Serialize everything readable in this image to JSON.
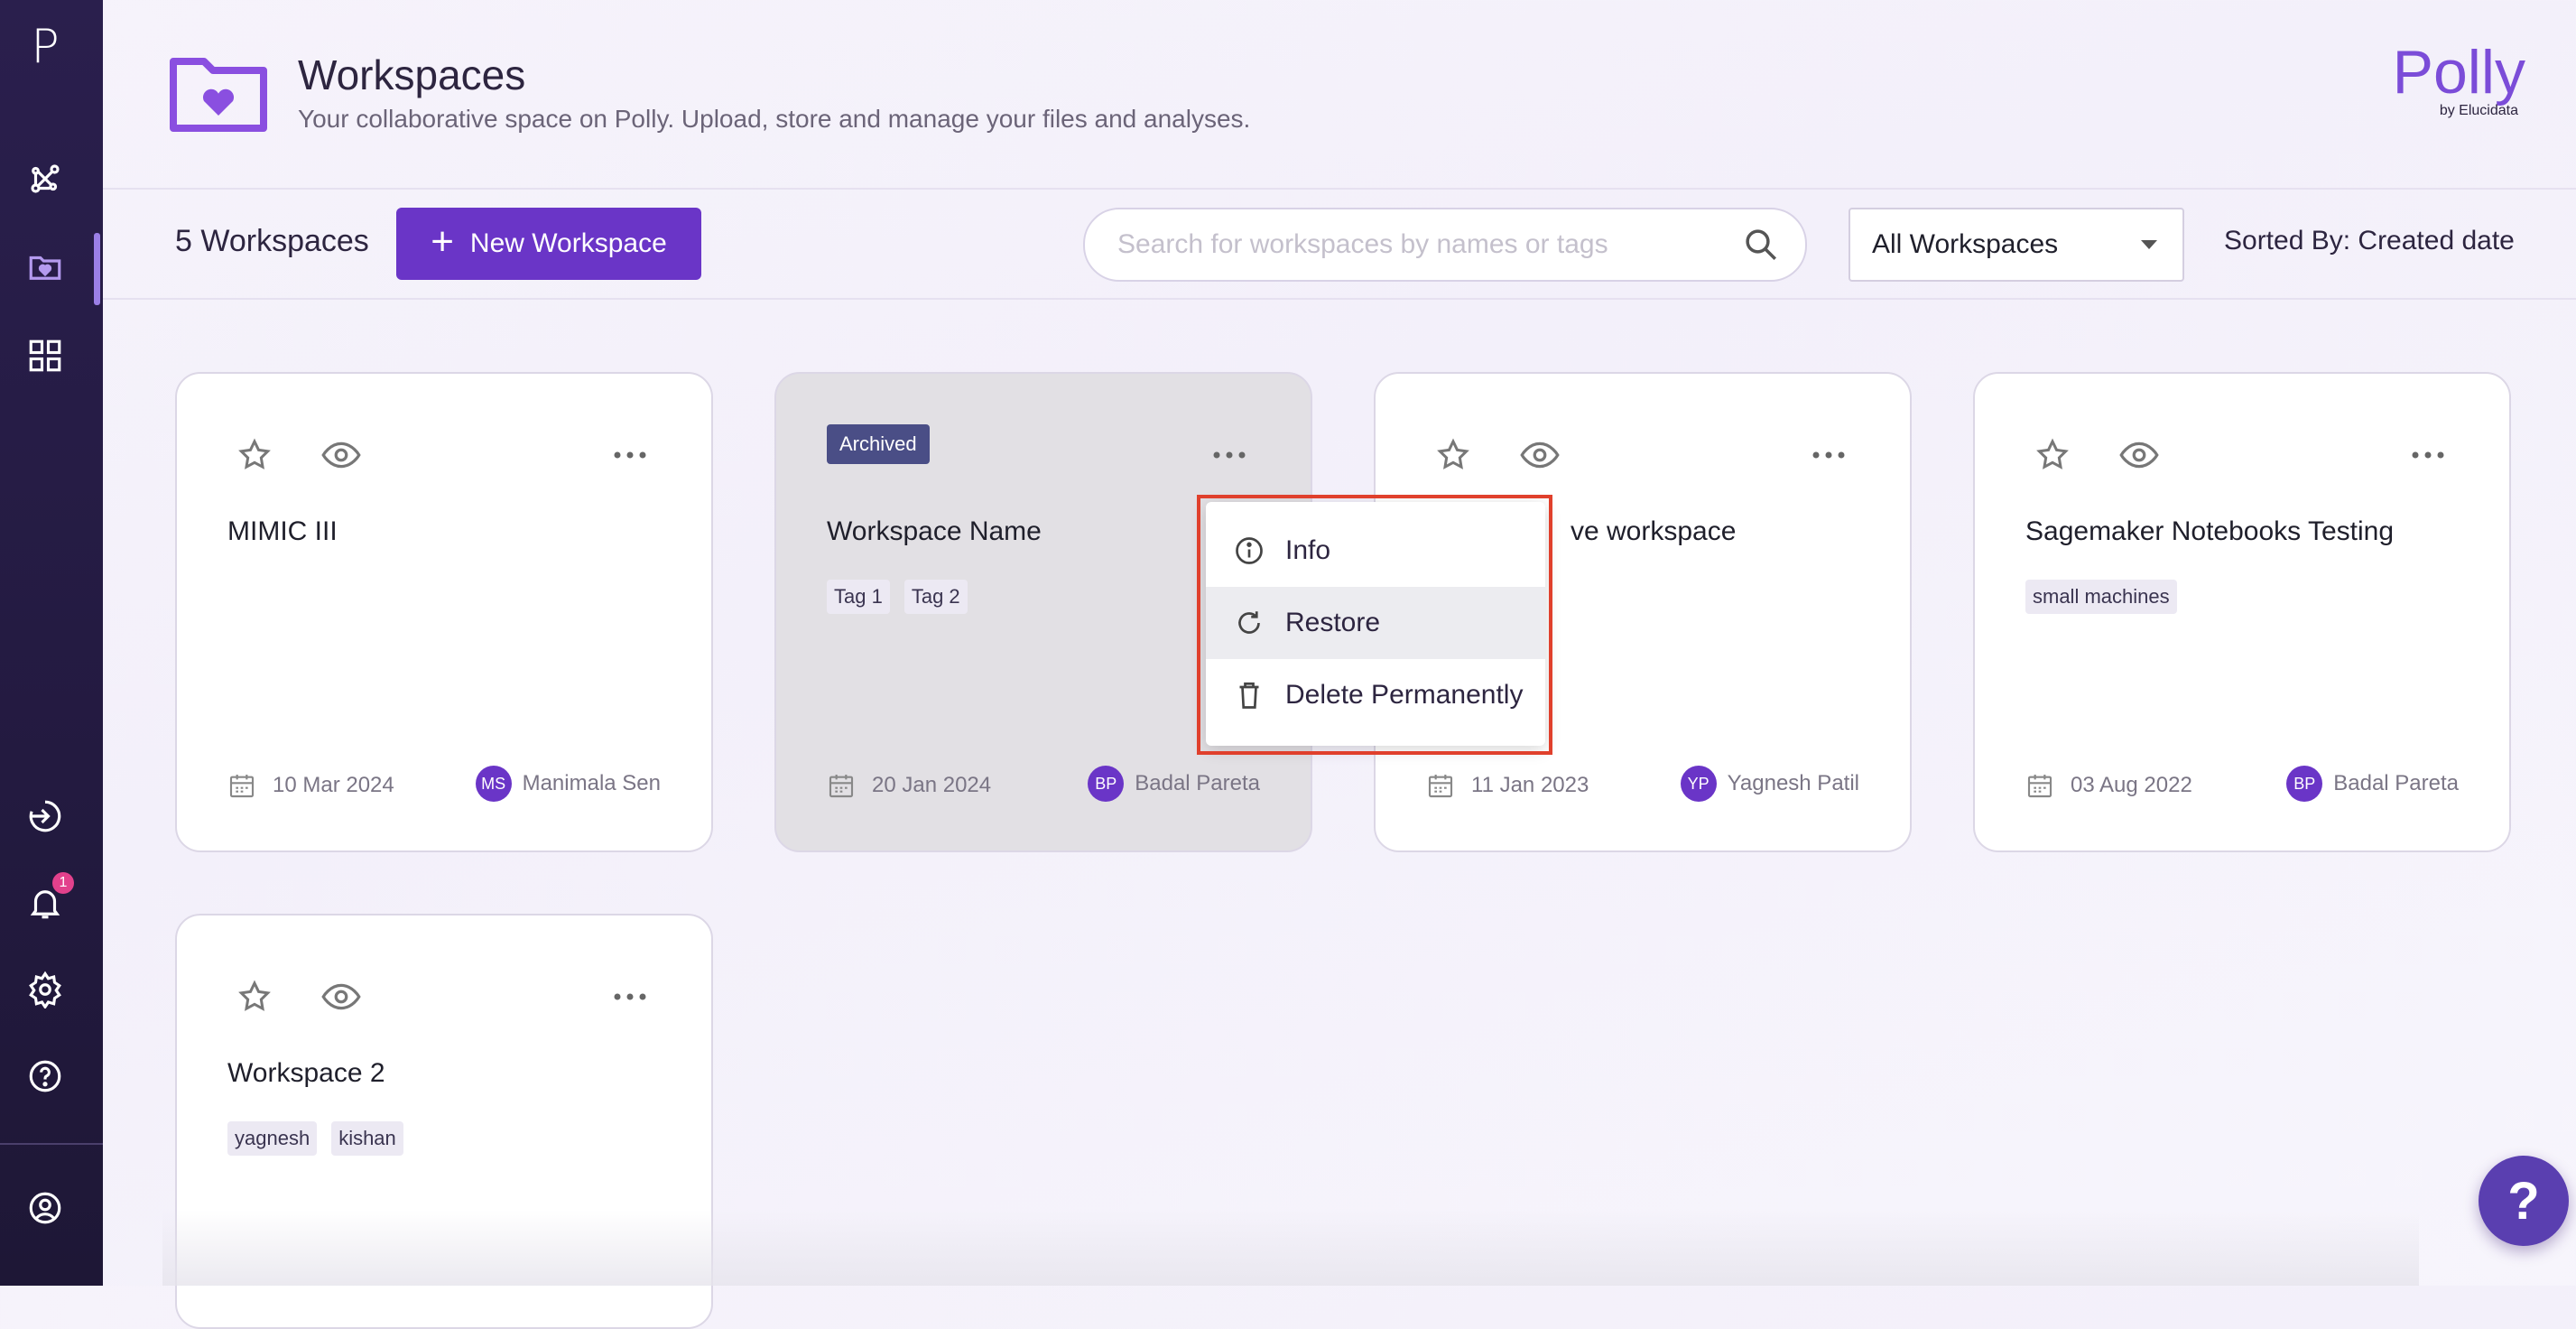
{
  "sidebar": {
    "logo": "P",
    "notification_count": "1",
    "items": [
      {
        "icon": "analysis-icon"
      },
      {
        "icon": "workspaces-icon",
        "active": true
      },
      {
        "icon": "apps-grid-icon"
      },
      {
        "icon": "logout-arrow-icon"
      },
      {
        "icon": "bell-icon"
      },
      {
        "icon": "settings-gear-icon"
      },
      {
        "icon": "help-circle-icon"
      },
      {
        "icon": "account-icon"
      }
    ]
  },
  "header": {
    "title": "Workspaces",
    "subtitle": "Your collaborative space on Polly. Upload, store and manage your files and analyses.",
    "brand": "Polly",
    "brand_sub": "by Elucidata"
  },
  "toolbar": {
    "count_label": "5 Workspaces",
    "new_button_label": "New Workspace",
    "search_placeholder": "Search for workspaces by names or tags",
    "filter_value": "All Workspaces",
    "sort_label": "Sorted By: Created date"
  },
  "cards": [
    {
      "title": "MIMIC III",
      "tags": [],
      "date": "10 Mar 2024",
      "owner_initials": "MS",
      "owner": "Manimala Sen"
    },
    {
      "title": "Workspace Name",
      "archived_label": "Archived",
      "tags": [
        "Tag 1",
        "Tag 2"
      ],
      "date": "20 Jan 2024",
      "owner_initials": "BP",
      "owner": "Badal Pareta"
    },
    {
      "title": "ve workspace",
      "tags": [],
      "date": "11 Jan 2023",
      "owner_initials": "YP",
      "owner": "Yagnesh Patil"
    },
    {
      "title": "Sagemaker Notebooks Testing",
      "tags": [
        "small machines"
      ],
      "date": "03 Aug 2022",
      "owner_initials": "BP",
      "owner": "Badal Pareta"
    },
    {
      "title": "Workspace 2",
      "tags": [
        "yagnesh",
        "kishan"
      ]
    }
  ],
  "context_menu": {
    "items": [
      {
        "label": "Info",
        "icon": "info-icon"
      },
      {
        "label": "Restore",
        "icon": "restore-icon"
      },
      {
        "label": "Delete Permanently",
        "icon": "trash-icon"
      }
    ]
  },
  "help_button": "?",
  "colors": {
    "accent": "#6a35c7",
    "sidebar": "#2a1f4d",
    "archived_badge": "#4a4e86",
    "highlight": "#e0402c"
  }
}
